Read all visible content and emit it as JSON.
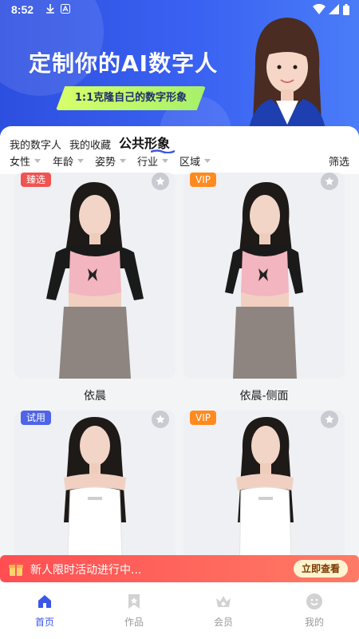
{
  "status_bar": {
    "time": "8:52"
  },
  "banner": {
    "title": "定制你的AI数字人",
    "subtitle": "1:1克隆自己的数字形象"
  },
  "tabs": [
    {
      "label": "我的数字人",
      "active": false
    },
    {
      "label": "我的收藏",
      "active": false
    },
    {
      "label": "公共形象",
      "active": true
    }
  ],
  "filters": {
    "items": [
      "女性",
      "年龄",
      "姿势",
      "行业",
      "区域"
    ],
    "filter_button": "筛选"
  },
  "cards": [
    {
      "name": "依晨",
      "badge": "臻选",
      "badge_type": "select",
      "favorite_icon": "star-icon"
    },
    {
      "name": "依晨-侧面",
      "badge": "VIP",
      "badge_type": "vip",
      "favorite_icon": "star-icon"
    },
    {
      "name": "",
      "badge": "试用",
      "badge_type": "trial",
      "favorite_icon": "star-icon"
    },
    {
      "name": "",
      "badge": "VIP",
      "badge_type": "vip",
      "favorite_icon": "star-icon"
    }
  ],
  "promo": {
    "text": "新人限时活动进行中...",
    "cta": "立即查看",
    "icon": "gift-icon"
  },
  "bottom_nav": [
    {
      "label": "首页",
      "icon": "home-icon",
      "active": true
    },
    {
      "label": "作品",
      "icon": "bookmark-icon",
      "active": false
    },
    {
      "label": "会员",
      "icon": "crown-icon",
      "active": false
    },
    {
      "label": "我的",
      "icon": "profile-icon",
      "active": false
    }
  ],
  "colors": {
    "accent": "#3a57e8",
    "banner": "#3a62f2",
    "promo": "#ff4e52"
  }
}
